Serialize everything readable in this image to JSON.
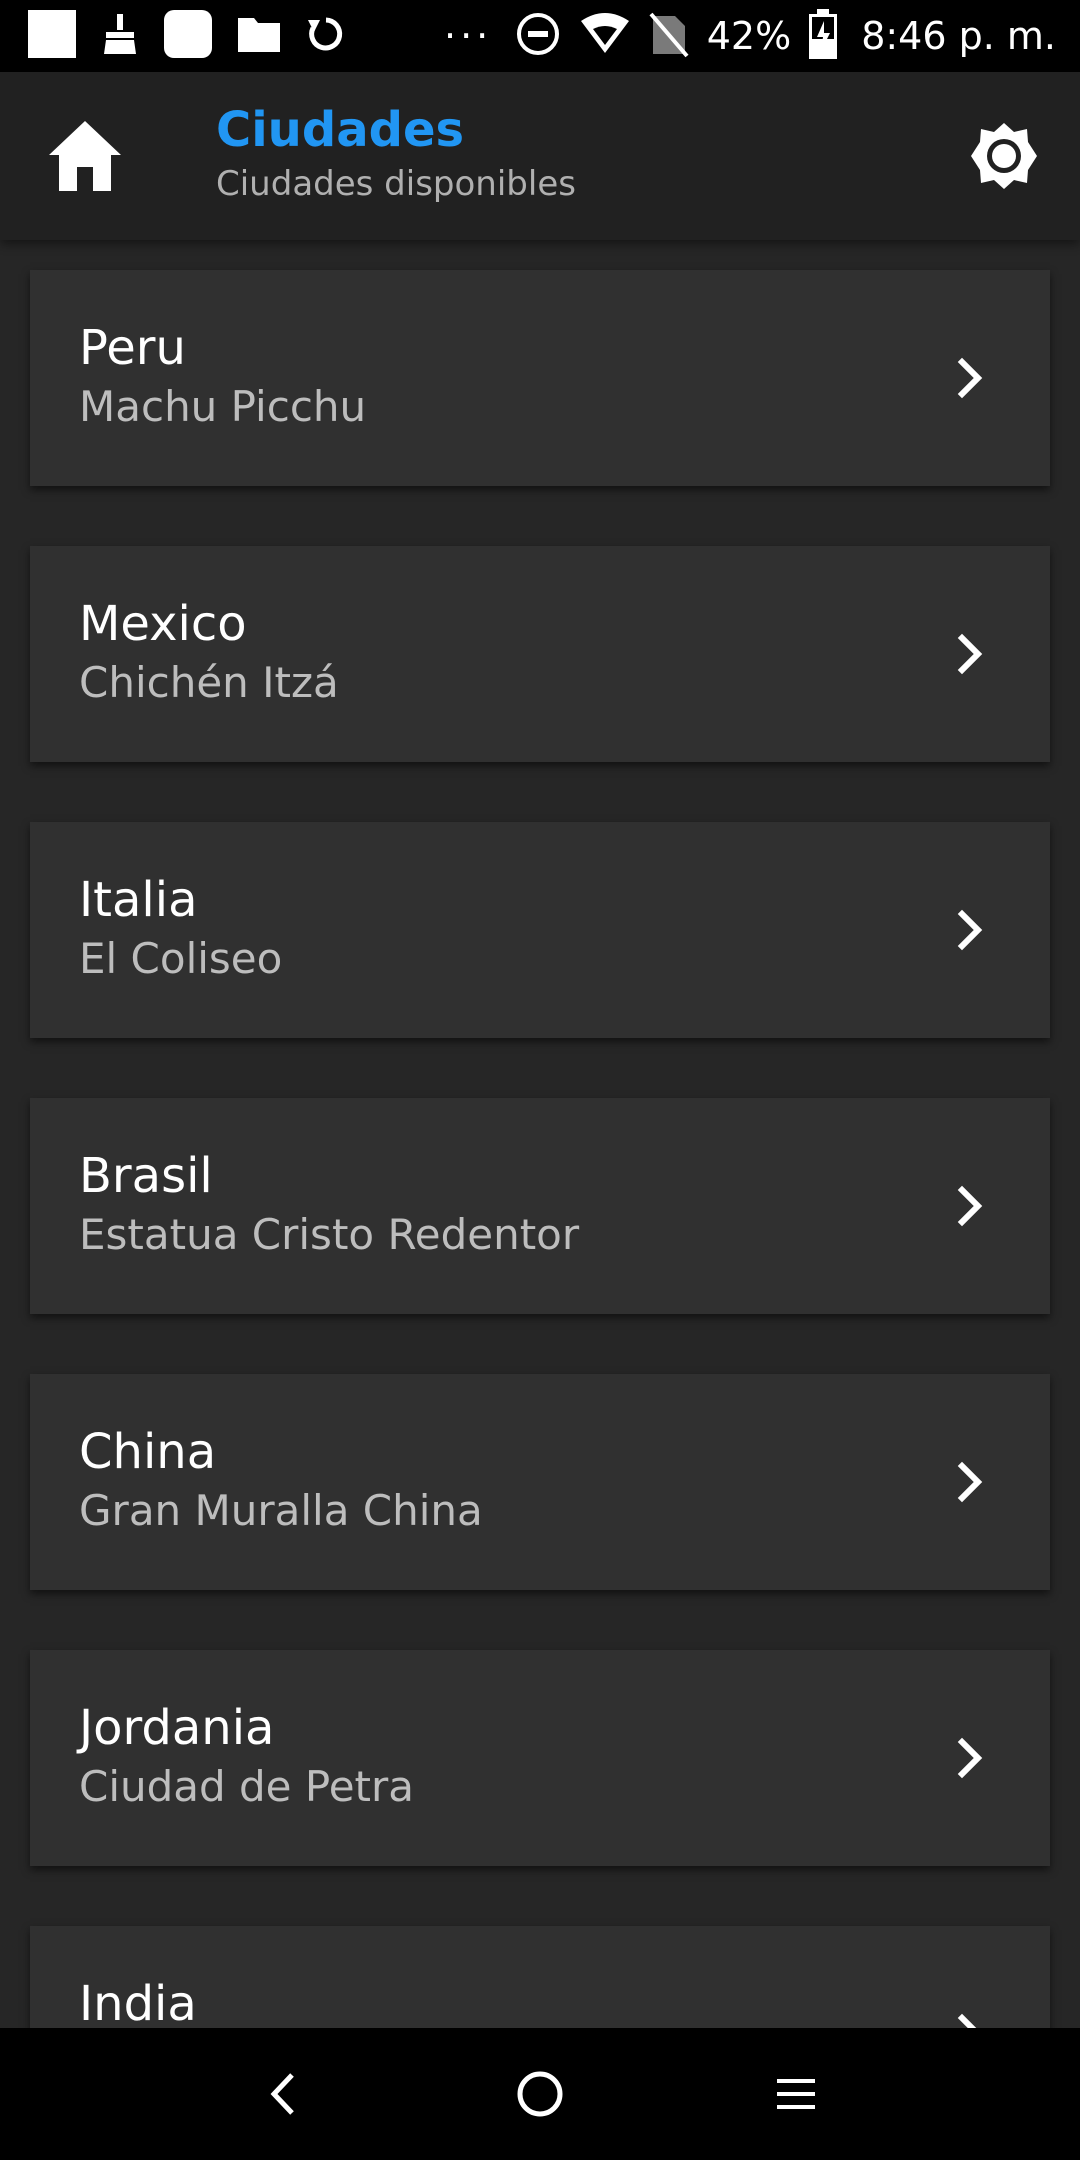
{
  "status_bar": {
    "battery": "42%",
    "time": "8:46 p. m.",
    "overflow": "···",
    "left_icons": [
      "app-square-icon",
      "broom-icon",
      "rounded-square-icon",
      "folder-icon",
      "sync-icon"
    ],
    "right_icons": [
      "do-not-disturb-icon",
      "wifi-icon",
      "no-sim-icon",
      "battery-charging-icon"
    ]
  },
  "appbar": {
    "title": "Ciudades",
    "subtitle": "Ciudades disponibles",
    "title_color": "#2196F3",
    "home_icon": "home-icon",
    "settings_icon": "brightness-icon"
  },
  "list": {
    "items": [
      {
        "name": "Peru",
        "place": "Machu Picchu"
      },
      {
        "name": "Mexico",
        "place": "Chichén Itzá"
      },
      {
        "name": "Italia",
        "place": "El Coliseo"
      },
      {
        "name": "Brasil",
        "place": "Estatua Cristo Redentor"
      },
      {
        "name": "China",
        "place": "Gran Muralla China"
      },
      {
        "name": "Jordania",
        "place": "Ciudad de Petra"
      },
      {
        "name": "India",
        "place": ""
      }
    ]
  },
  "nav_bar": {
    "buttons": [
      "back-icon",
      "home-circle-icon",
      "recents-icon"
    ]
  },
  "colors": {
    "background": "#262626",
    "card": "#303030",
    "appbar": "#212121",
    "accent": "#2196F3"
  }
}
